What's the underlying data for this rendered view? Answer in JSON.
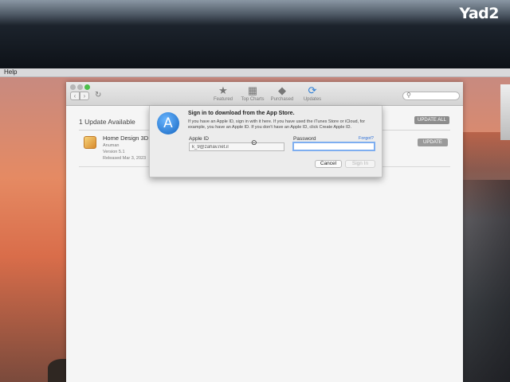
{
  "watermark": "Yad2",
  "menubar": {
    "help_label": "Help"
  },
  "toolbar": {
    "tabs": [
      {
        "label": "Featured",
        "icon": "star-icon"
      },
      {
        "label": "Top Charts",
        "icon": "list-icon"
      },
      {
        "label": "Purchased",
        "icon": "tag-icon"
      },
      {
        "label": "Updates",
        "icon": "updates-icon"
      }
    ],
    "search_placeholder": ""
  },
  "updates": {
    "count_text": "1 Update Available",
    "update_all_label": "UPDATE ALL",
    "items": [
      {
        "name": "Home Design 3D G",
        "developer": "Anuman",
        "version": "Version 5.1",
        "released": "Released Mar 3, 2023",
        "update_label": "UPDATE"
      }
    ]
  },
  "signin_sheet": {
    "title": "Sign in to download from the App Store.",
    "description": "If you have an Apple ID, sign in with it here. If you have used the iTunes Store or iCloud, for example, you have an Apple ID. If you don't have an Apple ID, click Create Apple ID.",
    "apple_id_label": "Apple ID",
    "apple_id_value": "k_9@zahav.net.il",
    "password_label": "Password",
    "password_value": "",
    "forgot_label": "Forgot?",
    "cancel_label": "Cancel",
    "signin_label": "Sign In"
  }
}
